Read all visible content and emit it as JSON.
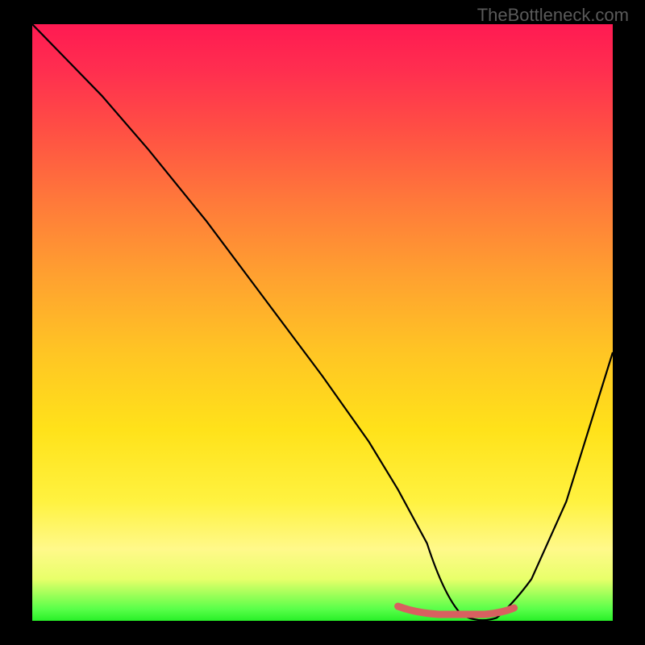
{
  "watermark": "TheBottleneck.com",
  "chart_data": {
    "type": "line",
    "title": "",
    "xlabel": "",
    "ylabel": "",
    "xlim": [
      0,
      100
    ],
    "ylim": [
      0,
      100
    ],
    "x": [
      0,
      6,
      12,
      20,
      30,
      40,
      50,
      58,
      63,
      68,
      72,
      76,
      80,
      86,
      92,
      100
    ],
    "values": [
      100,
      94,
      88,
      79,
      67,
      54,
      41,
      30,
      22,
      13,
      5,
      0,
      0,
      7,
      20,
      45
    ],
    "series": [
      {
        "name": "bottleneck-curve",
        "x": [
          0,
          6,
          12,
          20,
          30,
          40,
          50,
          58,
          63,
          68,
          72,
          76,
          80,
          86,
          92,
          100
        ],
        "values": [
          100,
          94,
          88,
          79,
          67,
          54,
          41,
          30,
          22,
          13,
          5,
          0,
          0,
          7,
          20,
          45
        ]
      }
    ],
    "highlight_segment": {
      "x": [
        63,
        68,
        72,
        76,
        80
      ],
      "values": [
        2,
        1,
        0,
        0,
        1
      ],
      "color": "#d86060"
    },
    "gradient_stops": [
      {
        "pos": 0,
        "color": "#ff1a52"
      },
      {
        "pos": 50,
        "color": "#ffc524"
      },
      {
        "pos": 90,
        "color": "#fff98a"
      },
      {
        "pos": 100,
        "color": "#28f028"
      }
    ]
  }
}
